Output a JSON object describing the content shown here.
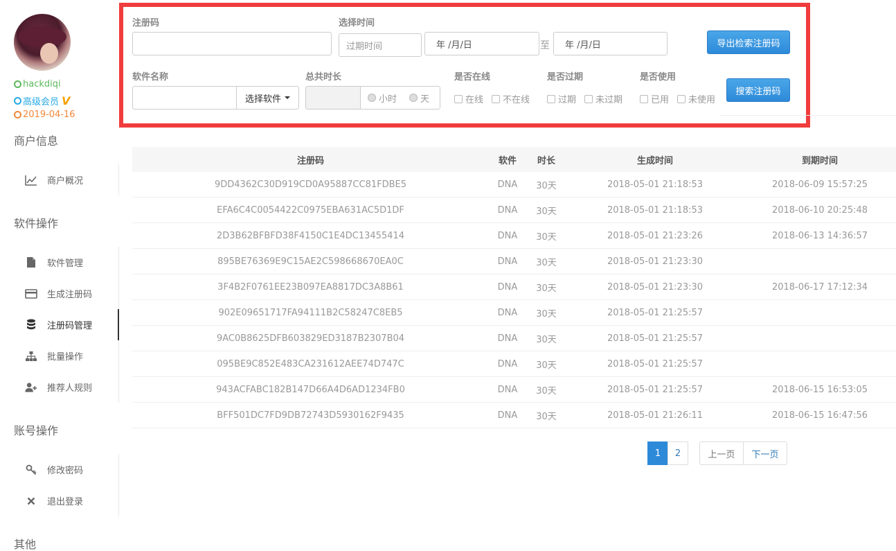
{
  "user": {
    "name": "hackdiqi",
    "level": "高级会员",
    "vip_mark": "V",
    "date": "2019-04-16"
  },
  "sidebar": {
    "sections": [
      {
        "title": "商户信息",
        "items": [
          {
            "label": "商户概况",
            "icon": "chart-icon"
          }
        ]
      },
      {
        "title": "软件操作",
        "items": [
          {
            "label": "软件管理",
            "icon": "file-icon"
          },
          {
            "label": "生成注册码",
            "icon": "card-icon"
          },
          {
            "label": "注册码管理",
            "icon": "database-icon"
          },
          {
            "label": "批量操作",
            "icon": "sitemap-icon"
          },
          {
            "label": "推荐人规则",
            "icon": "user-plus-icon"
          }
        ]
      },
      {
        "title": "账号操作",
        "items": [
          {
            "label": "修改密码",
            "icon": "key-icon"
          },
          {
            "label": "退出登录",
            "icon": "close-icon"
          }
        ]
      },
      {
        "title": "其他",
        "items": []
      }
    ],
    "active_item": "注册码管理"
  },
  "filter": {
    "code_label": "注册码",
    "code_value": "",
    "time_label": "选择时间",
    "expire_placeholder": "过期时间",
    "date_from": "年 /月/日",
    "date_sep": "至",
    "date_to": "年 /月/日",
    "export_button": "导出检索注册码",
    "software_label": "软件名称",
    "software_value": "",
    "select_software_button": "选择软件",
    "duration_label": "总共时长",
    "duration_value": "",
    "unit_hour": "小时",
    "unit_day": "天",
    "online_label": "是否在线",
    "online_yes": "在线",
    "online_no": "不在线",
    "expired_label": "是否过期",
    "expired_yes": "过期",
    "expired_no": "未过期",
    "used_label": "是否使用",
    "used_yes": "已用",
    "used_no": "未使用",
    "search_button": "搜索注册码"
  },
  "table": {
    "headers": {
      "code": "注册码",
      "software": "软件",
      "duration": "时长",
      "generated": "生成时间",
      "expires": "到期时间"
    },
    "rows": [
      {
        "code": "9DD4362C30D919CD0A95887CC81FDBE5",
        "software": "DNA",
        "duration": "30天",
        "generated": "2018-05-01 21:18:53",
        "expires": "2018-06-09 15:57:25"
      },
      {
        "code": "EFA6C4C0054422C0975EBA631AC5D1DF",
        "software": "DNA",
        "duration": "30天",
        "generated": "2018-05-01 21:18:53",
        "expires": "2018-06-10 20:25:48"
      },
      {
        "code": "2D3B62BFBFD38F4150C1E4DC13455414",
        "software": "DNA",
        "duration": "30天",
        "generated": "2018-05-01 21:23:26",
        "expires": "2018-06-13 14:36:57"
      },
      {
        "code": "895BE76369E9C15AE2C598668670EA0C",
        "software": "DNA",
        "duration": "30天",
        "generated": "2018-05-01 21:23:30",
        "expires": ""
      },
      {
        "code": "3F4B2F0761EE23B097EA8817DC3A8B61",
        "software": "DNA",
        "duration": "30天",
        "generated": "2018-05-01 21:23:30",
        "expires": "2018-06-17 17:12:34"
      },
      {
        "code": "902E09651717FA94111B2C58247C8EB5",
        "software": "DNA",
        "duration": "30天",
        "generated": "2018-05-01 21:25:57",
        "expires": ""
      },
      {
        "code": "9AC0B8625DFB603829ED3187B2307B04",
        "software": "DNA",
        "duration": "30天",
        "generated": "2018-05-01 21:25:57",
        "expires": ""
      },
      {
        "code": "095BE9C852E483CA231612AEE74D747C",
        "software": "DNA",
        "duration": "30天",
        "generated": "2018-05-01 21:25:57",
        "expires": ""
      },
      {
        "code": "943ACFABC182B147D66A4D6AD1234FB0",
        "software": "DNA",
        "duration": "30天",
        "generated": "2018-05-01 21:25:57",
        "expires": "2018-06-15 16:53:05"
      },
      {
        "code": "BFF501DC7FD9DB72743D5930162F9435",
        "software": "DNA",
        "duration": "30天",
        "generated": "2018-05-01 21:26:11",
        "expires": "2018-06-15 16:47:56"
      }
    ]
  },
  "pagination": {
    "pages": [
      "1",
      "2"
    ],
    "current": "1",
    "prev": "上一页",
    "next": "下一页"
  },
  "colors": {
    "accent": "#2d8ad9",
    "highlight_border": "#f03c3c",
    "online_green": "#5cb85c",
    "level_blue": "#27a9e3",
    "date_orange": "#f0883a"
  }
}
